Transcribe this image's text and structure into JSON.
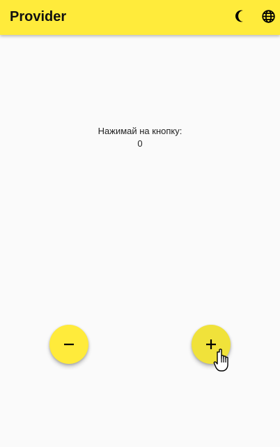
{
  "app_bar": {
    "title": "Provider",
    "background": "#ffeb3b",
    "actions": [
      {
        "icon": "moon-icon"
      },
      {
        "icon": "globe-icon"
      }
    ]
  },
  "counter": {
    "label": "Нажимай на кнопку:",
    "value": "0"
  },
  "buttons": {
    "decrement_icon": "minus-icon",
    "increment_icon": "plus-icon",
    "color": "#ffeb3b"
  },
  "cursor": {
    "icon": "hand-pointer-icon"
  }
}
